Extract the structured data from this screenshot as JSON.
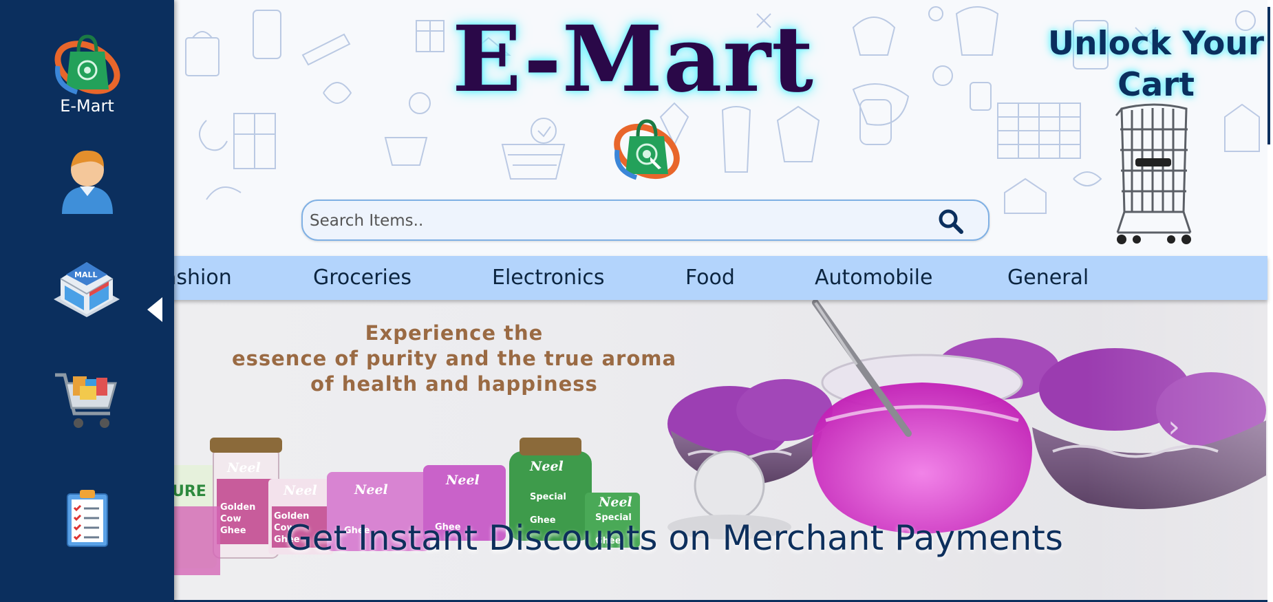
{
  "sidebar": {
    "brand_label": "E-Mart",
    "items": [
      {
        "name": "brand-logo",
        "icon": "shopping-bag-logo-icon"
      },
      {
        "name": "profile",
        "icon": "user-avatar-icon"
      },
      {
        "name": "mall",
        "icon": "mall-store-icon"
      },
      {
        "name": "cart",
        "icon": "shopping-cart-icon"
      },
      {
        "name": "orders",
        "icon": "clipboard-checklist-icon"
      }
    ],
    "collapse_icon": "chevron-left-icon",
    "background": "#0b2f5e"
  },
  "header": {
    "title": "E-Mart",
    "logo_icon": "shopping-bag-logo-icon",
    "search": {
      "placeholder": "Search Items..",
      "value": "",
      "icon": "search-icon"
    },
    "cart_promo": {
      "line1": "Unlock Your",
      "line2": "Cart",
      "icon": "shopping-trolley-icon"
    },
    "title_color": "#2a0848",
    "glow_color": "#6ef2ff"
  },
  "categories": [
    {
      "label": "Fashion",
      "visible_label": "ashion"
    },
    {
      "label": "Groceries"
    },
    {
      "label": "Electronics"
    },
    {
      "label": "Food"
    },
    {
      "label": "Automobile"
    },
    {
      "label": "General"
    }
  ],
  "banner": {
    "tagline_line1": "Experience the",
    "tagline_line2": "essence of purity and the true aroma",
    "tagline_line3": "of health and happiness",
    "product_brand": "Neel",
    "products": [
      {
        "line1": "Golden",
        "line2": "Cow",
        "line3": "Ghee"
      },
      {
        "line1": "Golden",
        "line2": "Cow",
        "line3": "Ghee"
      },
      {
        "line1": "",
        "line2": "",
        "line3": "Ghee"
      },
      {
        "line1": "",
        "line2": "",
        "line3": "Ghee"
      },
      {
        "line1": "Special",
        "line2": "",
        "line3": "Ghee"
      },
      {
        "line1": "Special",
        "line2": "",
        "line3": "Ghee"
      }
    ],
    "side_pack_text": "URE",
    "caption": "Get Instant Discounts on Merchant Payments",
    "next_icon": "chevron-right-icon",
    "next_glyph": "›",
    "accent_purple": "#c23fd1",
    "tagline_color": "#9a6a43"
  }
}
